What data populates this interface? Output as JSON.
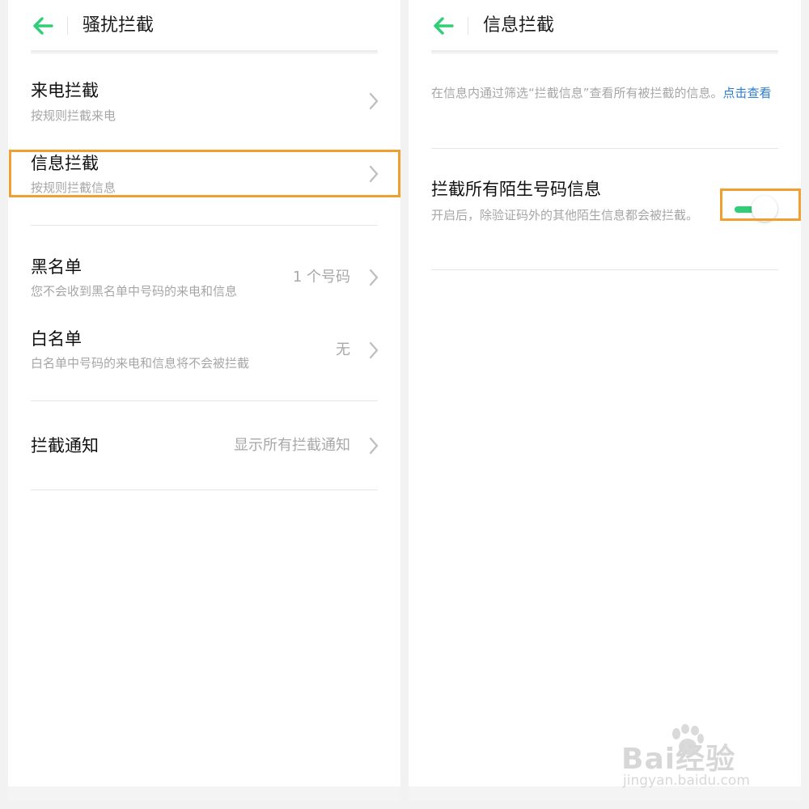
{
  "colors": {
    "accent": "#2fcf78",
    "link": "#2b7cd3",
    "highlight": "#f0a030"
  },
  "left_panel": {
    "header": {
      "back_icon": "back-arrow-icon",
      "title": "骚扰拦截"
    },
    "rows": [
      {
        "title": "来电拦截",
        "subtitle": "按规则拦截来电"
      },
      {
        "title": "信息拦截",
        "subtitle": "按规则拦截信息"
      },
      {
        "title": "黑名单",
        "subtitle": "您不会收到黑名单中号码的来电和信息",
        "value": "1 个号码"
      },
      {
        "title": "白名单",
        "subtitle": "白名单中号码的来电和信息将不会被拦截",
        "value": "无"
      },
      {
        "title": "拦截通知",
        "value": "显示所有拦截通知"
      }
    ]
  },
  "right_panel": {
    "header": {
      "back_icon": "back-arrow-icon",
      "title": "信息拦截"
    },
    "info": {
      "text": "在信息内通过筛选“拦截信息”查看所有被拦截的信息。",
      "link": "点击查看"
    },
    "setting": {
      "title": "拦截所有陌生号码信息",
      "subtitle": "开启后，除验证码外的其他陌生信息都会被拦截。",
      "enabled": true
    }
  },
  "watermark": {
    "brand": "Bai经验",
    "url": "jingyan.baidu.com"
  }
}
